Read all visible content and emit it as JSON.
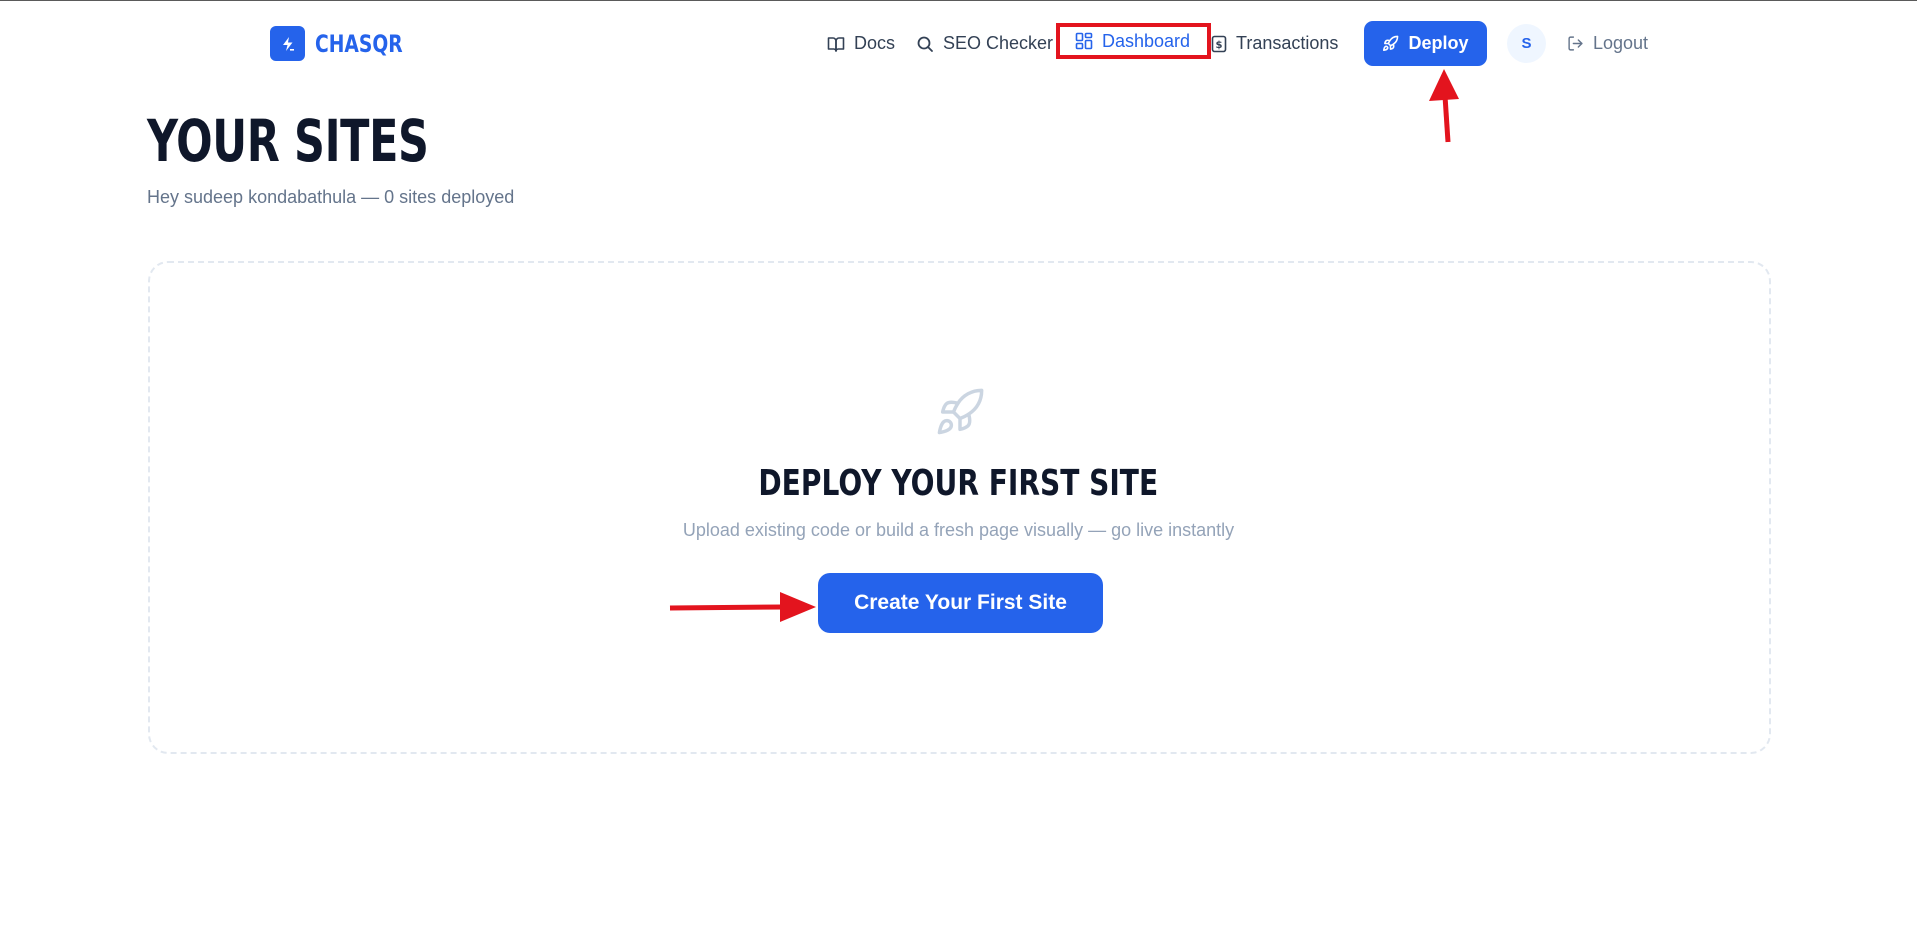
{
  "brand": {
    "name": "CHASQR",
    "accent": "#2563eb"
  },
  "nav": {
    "docs": "Docs",
    "seo": "SEO Checker",
    "dashboard": "Dashboard",
    "transactions": "Transactions",
    "deploy": "Deploy",
    "avatar_initial": "S",
    "logout": "Logout"
  },
  "page": {
    "title": "YOUR SITES",
    "subtitle": "Hey sudeep kondabathula — 0 sites deployed"
  },
  "empty_state": {
    "icon": "rocket-icon",
    "title": "DEPLOY YOUR FIRST SITE",
    "description": "Upload existing code or build a fresh page visually — go live instantly",
    "cta": "Create Your First Site"
  },
  "annotations": {
    "color": "#e3141e",
    "highlight": "dashboard-nav",
    "arrows": [
      "deploy-button",
      "create-first-site-button"
    ]
  }
}
